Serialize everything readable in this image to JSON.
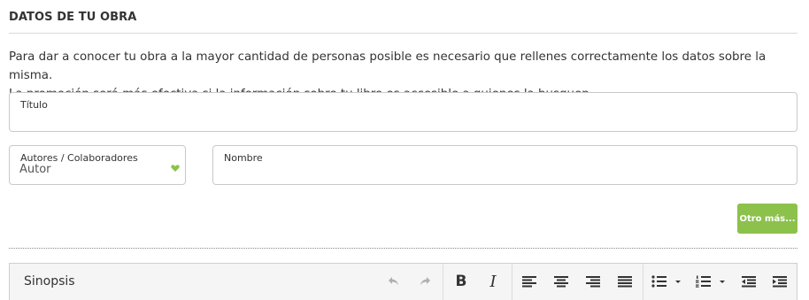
{
  "section": {
    "title": "DATOS DE TU OBRA",
    "intro_line1": "Para dar a conocer tu obra a la mayor cantidad de personas posible es necesario que rellenes correctamente los datos sobre la misma.",
    "intro_line2": "La promoción será más efectiva si la información sobre tu libro es accesible a quienes la busquen.."
  },
  "fields": {
    "titulo": {
      "label": "Título",
      "value": ""
    },
    "autores": {
      "label": "Autores / Colaboradores",
      "value": "Autor"
    },
    "nombre": {
      "label": "Nombre",
      "value": ""
    }
  },
  "buttons": {
    "otro_mas": "Otro más..."
  },
  "editor": {
    "label": "Sinopsis",
    "toolbar": {
      "bold": "B",
      "italic": "I",
      "icons": [
        "undo-icon",
        "redo-icon",
        "bold-icon",
        "italic-icon",
        "align-left-icon",
        "align-center-icon",
        "align-right-icon",
        "align-justify-icon",
        "bullet-list-icon",
        "numbered-list-icon",
        "outdent-icon",
        "indent-icon"
      ]
    }
  },
  "colors": {
    "accent": "#8cc14c",
    "text": "#333333",
    "border": "#c9c9c9",
    "toolbar_bg": "#f5f5f5",
    "disabled_icon": "#b0b0b0"
  }
}
